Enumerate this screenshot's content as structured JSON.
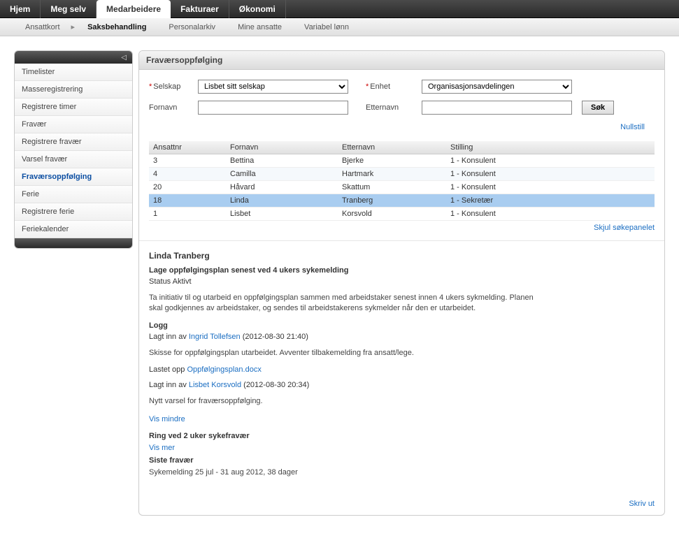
{
  "topnav": {
    "tabs": [
      "Hjem",
      "Meg selv",
      "Medarbeidere",
      "Fakturaer",
      "Økonomi"
    ],
    "active_index": 2
  },
  "subnav": {
    "items": [
      "Ansattkort",
      "Saksbehandling",
      "Personalarkiv",
      "Mine ansatte",
      "Variabel lønn"
    ],
    "active_index": 1
  },
  "sidebar": {
    "items": [
      "Timelister",
      "Masseregistrering",
      "Registrere timer",
      "Fravær",
      "Registrere fravær",
      "Varsel fravær",
      "Fraværsoppfølging",
      "Ferie",
      "Registrere ferie",
      "Feriekalender"
    ],
    "active_index": 6
  },
  "panel": {
    "title": "Fraværsoppfølging",
    "labels": {
      "selskap": "Selskap",
      "enhet": "Enhet",
      "fornavn": "Fornavn",
      "etternavn": "Etternavn"
    },
    "selskap_value": "Lisbet sitt selskap",
    "enhet_value": "Organisasjonsavdelingen",
    "fornavn_value": "",
    "etternavn_value": "",
    "search_button": "Søk",
    "reset_link": "Nullstill",
    "hide_panel_link": "Skjul søkepanelet"
  },
  "table": {
    "headers": [
      "Ansattnr",
      "Fornavn",
      "Etternavn",
      "Stilling"
    ],
    "rows": [
      {
        "nr": "3",
        "fornavn": "Bettina",
        "etternavn": "Bjerke",
        "stilling": "1 - Konsulent"
      },
      {
        "nr": "4",
        "fornavn": "Camilla",
        "etternavn": "Hartmark",
        "stilling": "1 - Konsulent"
      },
      {
        "nr": "20",
        "fornavn": "Håvard",
        "etternavn": "Skattum",
        "stilling": "1 - Konsulent"
      },
      {
        "nr": "18",
        "fornavn": "Linda",
        "etternavn": "Tranberg",
        "stilling": "1 - Sekretær"
      },
      {
        "nr": "1",
        "fornavn": "Lisbet",
        "etternavn": "Korsvold",
        "stilling": "1 - Konsulent"
      }
    ],
    "selected_index": 3
  },
  "detail": {
    "name": "Linda Tranberg",
    "task_title": "Lage oppfølgingsplan senest ved 4 ukers sykemelding",
    "status_label": "Status",
    "status_value": "Aktivt",
    "description": "Ta initiativ til og utarbeid en oppfølgingsplan sammen med arbeidstaker senest innen 4 ukers sykmelding. Planen skal godkjennes av arbeidstaker, og sendes til arbeidstakerens sykmelder når den er utarbeidet.",
    "log_heading": "Logg",
    "log1_prefix": "Lagt inn av ",
    "log1_user": "Ingrid Tollefsen",
    "log1_suffix": " (2012-08-30 21:40)",
    "log1_text": "Skisse for oppfølgingsplan utarbeidet. Avventer tilbakemelding fra ansatt/lege.",
    "upload_prefix": "Lastet opp ",
    "upload_file": "Oppfølgingsplan.docx",
    "log2_prefix": "Lagt inn av ",
    "log2_user": "Lisbet Korsvold",
    "log2_suffix": " (2012-08-30 20:34)",
    "log2_text": "Nytt varsel for fraværsoppfølging.",
    "show_less": "Vis mindre",
    "task2_title": "Ring ved 2 uker sykefravær",
    "show_more": "Vis mer",
    "last_absence_heading": "Siste fravær",
    "last_absence_text": "Sykemelding 25 jul - 31 aug 2012, 38 dager",
    "print_link": "Skriv ut"
  }
}
